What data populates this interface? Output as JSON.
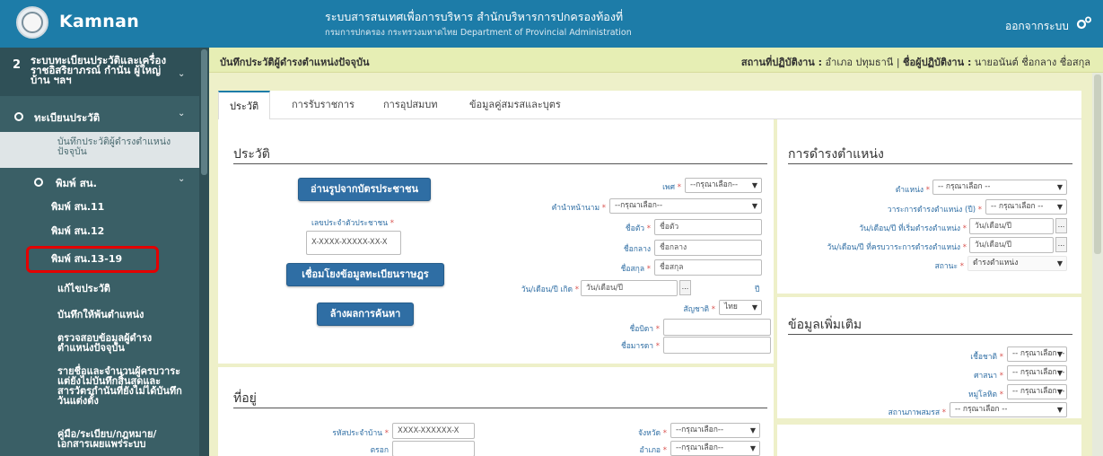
{
  "app": {
    "brand": "Kamnan",
    "system_title": "ระบบสารสนเทศเพื่อการบริหาร สำนักบริหารการปกครองท้องที่",
    "system_subtitle": "กรมการปกครอง กระทรวงมหาดไทย Department of Provincial Administration",
    "logout_label": "ออกจากระบบ",
    "settings_icon": "gear-icon"
  },
  "sidebar": {
    "section_number": "2",
    "section_label": "ระบบทะเบียนประวัติและเครื่องราชอิสริยาภรณ์ กำนัน ผู้ใหญ่บ้าน ฯลฯ",
    "registry_label": "ทะเบียนประวัติ",
    "active_item": "บันทึกประวัติผู้ดำรงตำแหน่งปัจจุบัน",
    "print_group": "พิมพ์ สน.",
    "print_items": [
      "พิมพ์ สน.11",
      "พิมพ์ สน.12",
      "พิมพ์ สน.13-19"
    ],
    "items": [
      "แก้ไขประวัติ",
      "บันทึกให้พ้นตำแหน่ง",
      "ตรวจสอบข้อมูลผู้ดำรงตำแหน่งปัจจุบัน",
      "รายชื่อและจำนวนผู้ครบวาระแต่ยังไม่บันทึกสิ้นสุดและสารวัตรกำนันที่ยังไม่ได้บันทึกวันแต่งตั้ง",
      "คู่มือ/ระเบียบ/กฎหมาย/เอกสารเผยแพร่ระบบ"
    ],
    "highlight_color": "#e40000"
  },
  "header": {
    "breadcrumb": "บันทึกประวัติผู้ดำรงตำแหน่งปัจจุบัน",
    "workplace_label": "สถานที่ปฏิบัติงาน :",
    "workplace_value": "อำเภอ ปทุมธานี",
    "separator": "|",
    "operator_label": "ชื่อผู้ปฏิบัติงาน :",
    "operator_value": "นายอนันต์ ชื่อกลาง ชื่อสกุล"
  },
  "tabs": [
    "ประวัติ",
    "การรับราชการ",
    "การอุปสมบท",
    "ข้อมูลคู่สมรสและบุตร"
  ],
  "profile": {
    "title": "ประวัติ",
    "read_card_button": "อ่านรูปจากบัตรประชาชน",
    "id_label": "เลขประจำตัวประชาชน",
    "id_placeholder": "X-XXXX-XXXXX-XX-X",
    "link_button": "เชื่อมโยงข้อมูลทะเบียนราษฎร",
    "clear_button": "ล้างผลการค้นหา",
    "gender_label": "เพศ",
    "gender_value": "--กรุณาเลือก--",
    "prefix_label": "คำนำหน้านาม",
    "prefix_value": "--กรุณาเลือก--",
    "first_name_label": "ชื่อตัว",
    "first_name_placeholder": "ชื่อตัว",
    "middle_name_label": "ชื่อกลาง",
    "middle_name_placeholder": "ชื่อกลาง",
    "last_name_label": "ชื่อสกุล",
    "last_name_placeholder": "ชื่อสกุล",
    "birth_label": "วัน/เดือน/ปี เกิด",
    "birth_placeholder": "วัน/เดือน/ปี",
    "birth_btn": "...",
    "year_unit": "ปี",
    "nationality_label": "สัญชาติ",
    "nationality_value": "ไทย",
    "father_label": "ชื่อบิดา",
    "mother_label": "ชื่อมารดา",
    "required_mark": "*"
  },
  "position": {
    "title": "การดำรงตำแหน่ง",
    "position_label": "ตำแหน่ง",
    "position_value": "-- กรุณาเลือก --",
    "term_label": "วาระการดำรงตำแหน่ง (ปี)",
    "term_value": "-- กรุณาเลือก --",
    "start_label": "วัน/เดือน/ปี ที่เริ่มดำรงตำแหน่ง",
    "start_placeholder": "วัน/เดือน/ปี",
    "end_label": "วัน/เดือน/ปี ที่ครบวาระการดำรงตำแหน่ง",
    "end_placeholder": "วัน/เดือน/ปี",
    "date_btn": "...",
    "status_label": "สถานะ",
    "status_value": "ดำรงตำแหน่ง"
  },
  "extra": {
    "title": "ข้อมูลเพิ่มเติม",
    "race_label": "เชื้อชาติ",
    "race_value": "-- กรุณาเลือก --",
    "religion_label": "ศาสนา",
    "religion_value": "-- กรุณาเลือก --",
    "blood_label": "หมู่โลหิต",
    "blood_value": "-- กรุณาเลือก --",
    "marital_label": "สถานภาพสมรส",
    "marital_value": "-- กรุณาเลือก --"
  },
  "address": {
    "title": "ที่อยู่",
    "house_code_label": "รหัสประจำบ้าน",
    "house_code_placeholder": "XXXX-XXXXXX-X",
    "alley_label": "ตรอก",
    "province_label": "จังหวัด",
    "province_value": "--กรุณาเลือก--",
    "district_label": "อำเภอ",
    "district_value": "--กรุณาเลือก--"
  }
}
